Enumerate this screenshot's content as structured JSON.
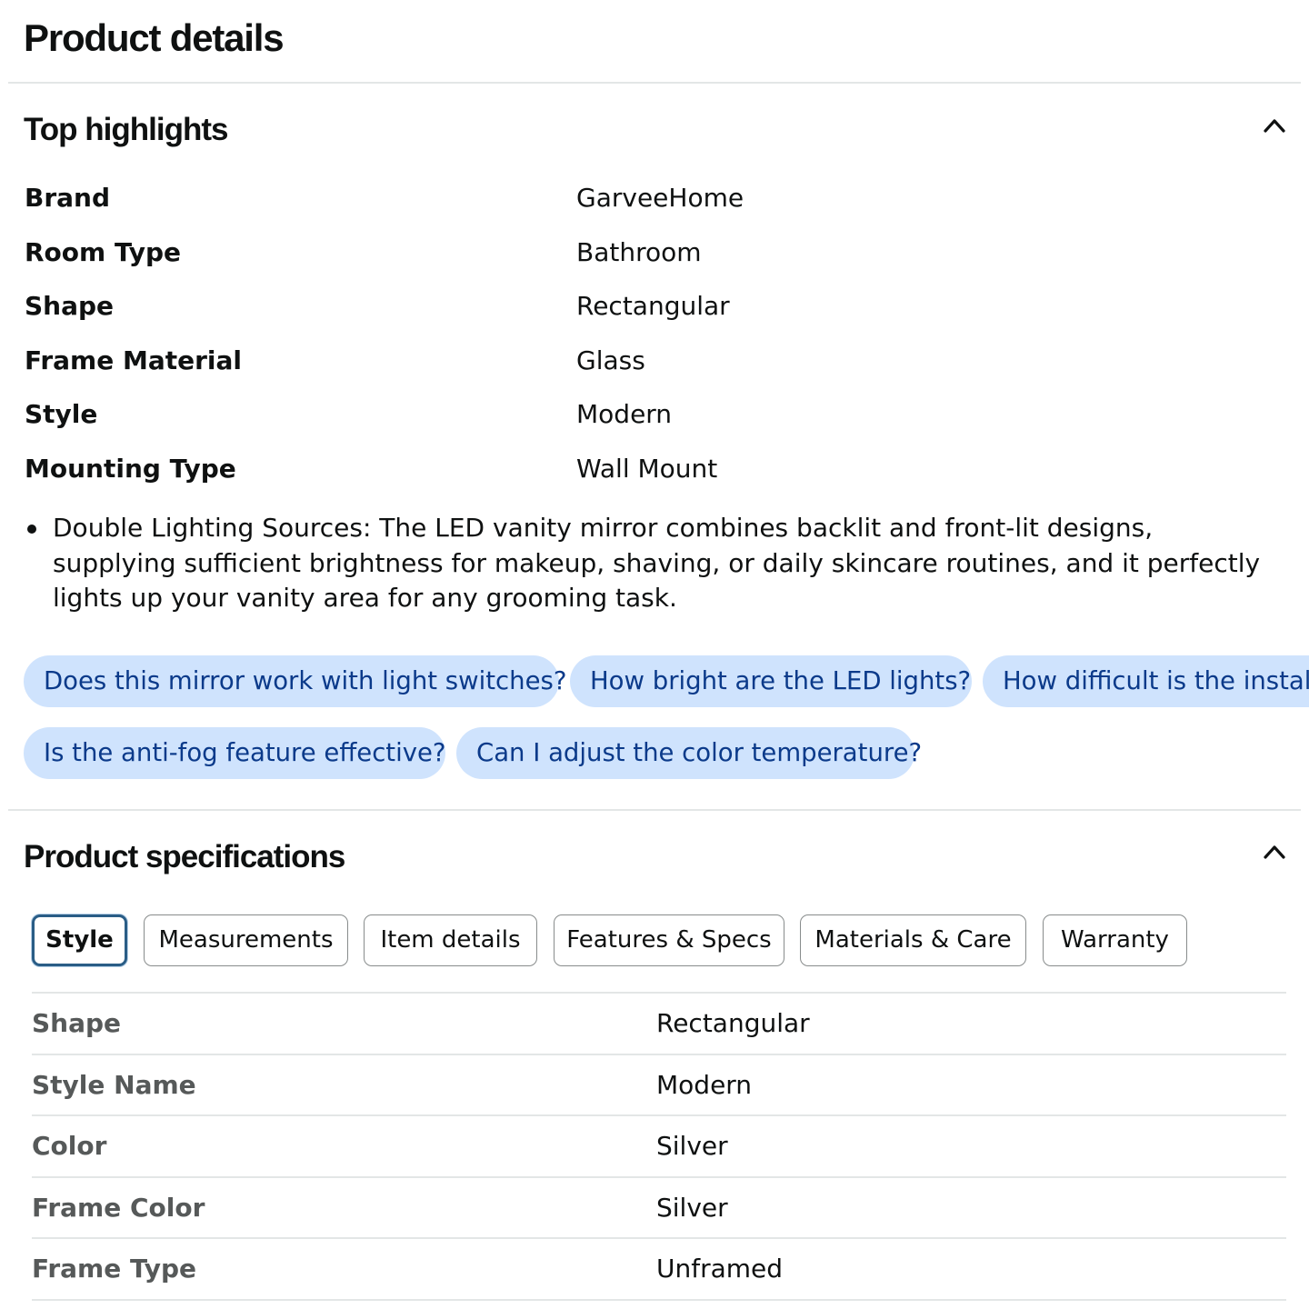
{
  "page": {
    "title": "Product details"
  },
  "top_highlights": {
    "title": "Top highlights",
    "collapse_icon": "chevron-up-icon",
    "rows": [
      {
        "label": "Brand",
        "value": "GarveeHome"
      },
      {
        "label": "Room Type",
        "value": "Bathroom"
      },
      {
        "label": "Shape",
        "value": "Rectangular"
      },
      {
        "label": "Frame Material",
        "value": "Glass"
      },
      {
        "label": "Style",
        "value": "Modern"
      },
      {
        "label": "Mounting Type",
        "value": "Wall Mount"
      }
    ],
    "bullets": [
      "Double Lighting Sources: The LED vanity mirror combines backlit and front-lit designs, supplying sufficient brightness for makeup, shaving, or daily skincare routines, and it perfectly lights up your vanity area for any grooming task."
    ],
    "questions": [
      "Does this mirror work with light switches?",
      "How bright are the LED lights?",
      "How difficult is the install",
      "Is the anti-fog feature effective?",
      "Can I adjust the color temperature?"
    ]
  },
  "product_specifications": {
    "title": "Product specifications",
    "collapse_icon": "chevron-up-icon",
    "tabs": [
      {
        "label": "Style",
        "selected": true
      },
      {
        "label": "Measurements",
        "selected": false
      },
      {
        "label": "Item details",
        "selected": false
      },
      {
        "label": "Features & Specs",
        "selected": false
      },
      {
        "label": "Materials & Care",
        "selected": false
      },
      {
        "label": "Warranty",
        "selected": false
      }
    ],
    "rows": [
      {
        "label": "Shape",
        "value": "Rectangular"
      },
      {
        "label": "Style Name",
        "value": "Modern"
      },
      {
        "label": "Color",
        "value": "Silver"
      },
      {
        "label": "Frame Color",
        "value": "Silver"
      },
      {
        "label": "Frame Type",
        "value": "Unframed"
      }
    ]
  },
  "colors": {
    "chip_background": "#cfe3fd",
    "chip_text": "#0b3a8a",
    "active_tab_border": "#2a5d86",
    "divider": "#e3e6e6",
    "spec_label": "#565959"
  }
}
